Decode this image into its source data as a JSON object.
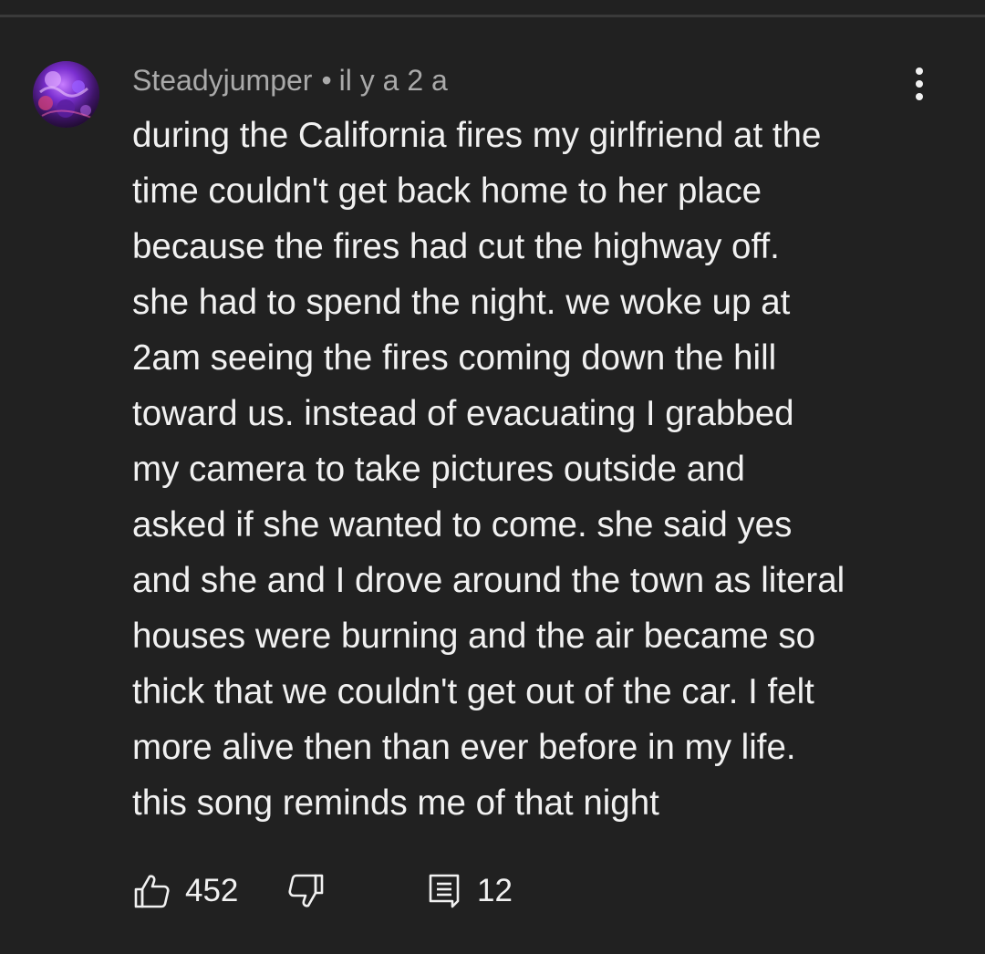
{
  "comment": {
    "author": "Steadyjumper",
    "separator": "•",
    "timestamp": "il y a 2 a",
    "text_lines": [
      "during the California fires my girlfriend at the",
      "time couldn't get back home to her place",
      "because the fires had cut the highway off.",
      "she had to spend the night. we woke up at",
      "2am seeing the fires coming down the hill",
      "toward us. instead of evacuating I grabbed",
      "my camera to take pictures outside and",
      "asked if she wanted to come. she said yes",
      "and she and I drove around the town as literal",
      "houses were burning and the air became so",
      "thick that we couldn't get out of the car. I felt",
      "more alive then than ever before in my life.",
      "this song reminds me of that night"
    ],
    "like_count": "452",
    "reply_count": "12"
  },
  "icons": {
    "avatar": "avatar-image",
    "more": "more-vert-icon",
    "like": "thumbs-up-icon",
    "dislike": "thumbs-down-icon",
    "reply": "comment-reply-icon"
  },
  "colors": {
    "background": "#212121",
    "text_primary": "#f1f1f1",
    "text_secondary": "#aaaaaa"
  }
}
